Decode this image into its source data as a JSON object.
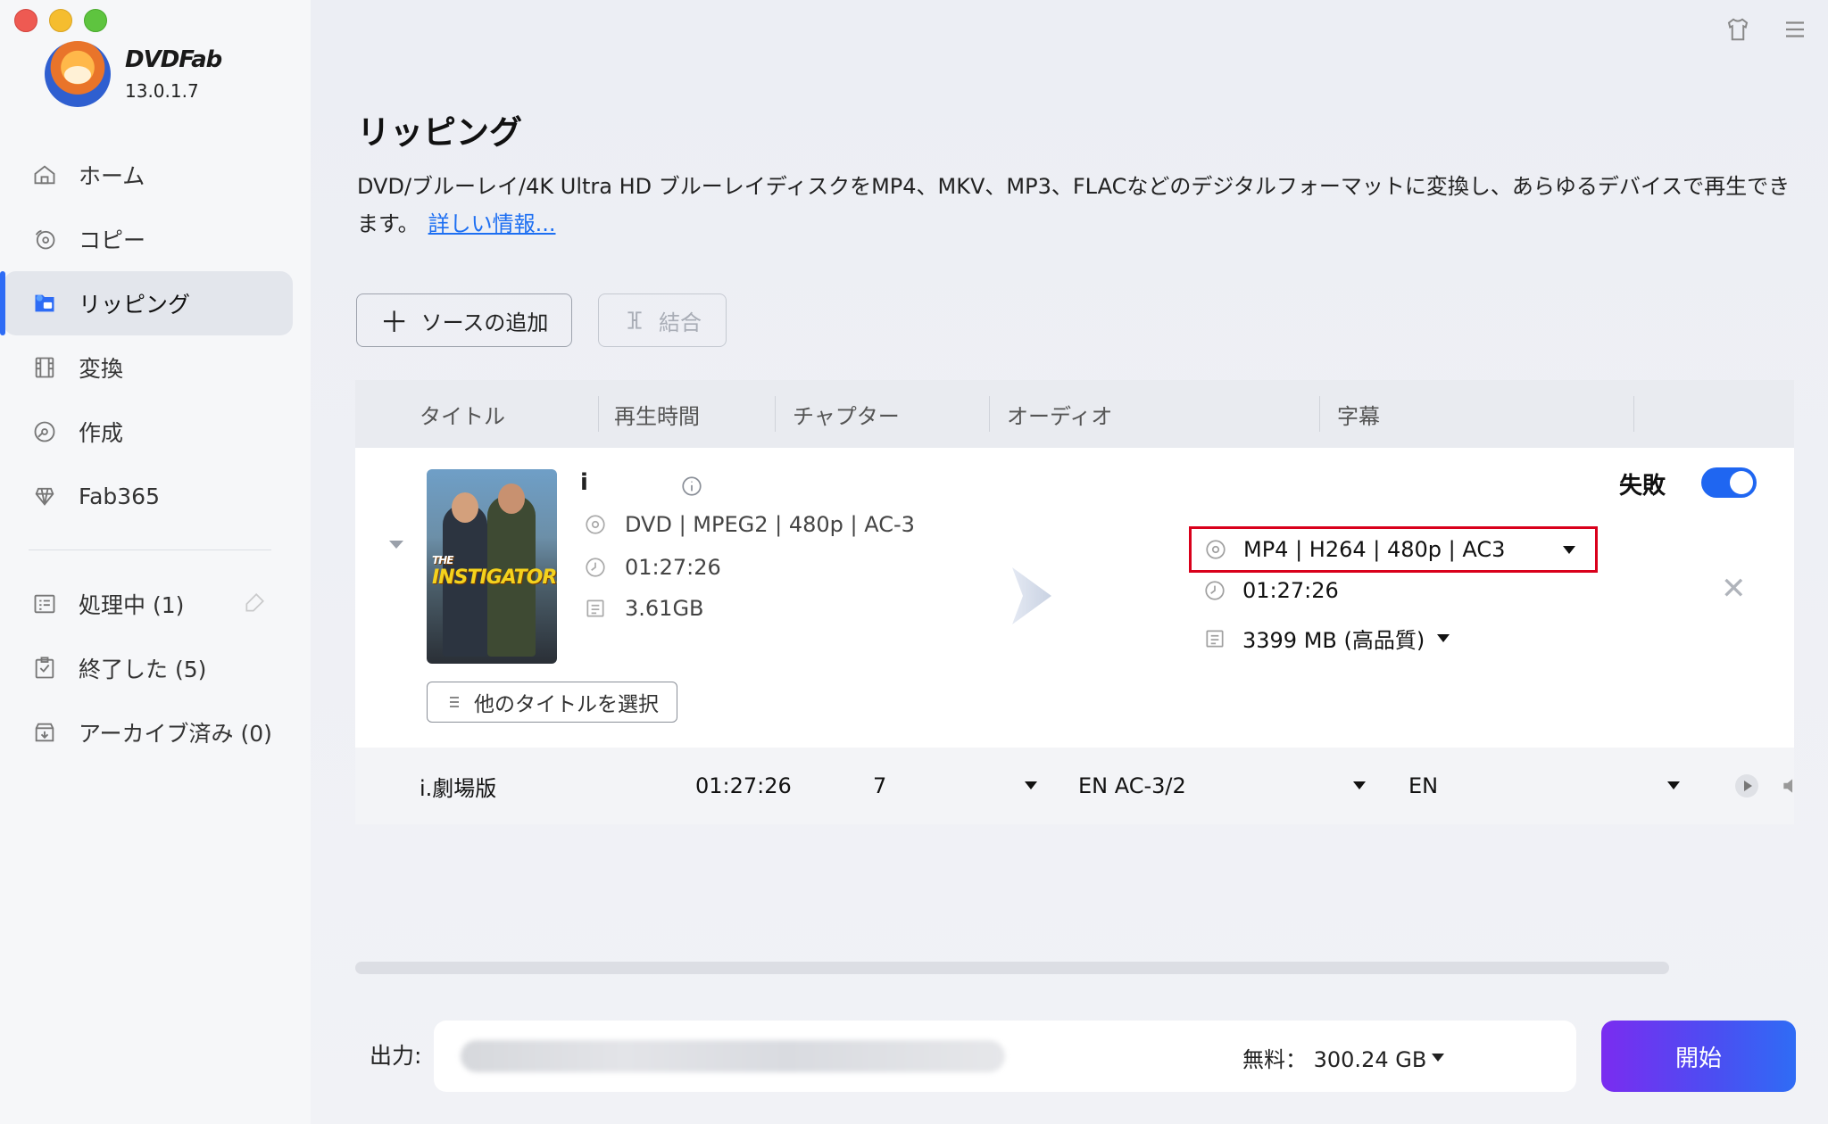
{
  "app": {
    "brand": "DVDFab",
    "version": "13.0.1.7"
  },
  "sidebar": {
    "items": [
      {
        "label": "ホーム",
        "icon": "home-icon"
      },
      {
        "label": "コピー",
        "icon": "copy-icon"
      },
      {
        "label": "リッピング",
        "icon": "ripper-icon",
        "active": true
      },
      {
        "label": "変換",
        "icon": "convert-icon"
      },
      {
        "label": "作成",
        "icon": "create-icon"
      },
      {
        "label": "Fab365",
        "icon": "fab365-icon"
      }
    ],
    "queue": [
      {
        "label": "処理中 (1)",
        "icon": "processing-icon"
      },
      {
        "label": "終了した (5)",
        "icon": "finished-icon"
      },
      {
        "label": "アーカイブ済み (0)",
        "icon": "archive-icon"
      }
    ]
  },
  "main": {
    "title": "リッピング",
    "description": "DVD/ブルーレイ/4K Ultra HD ブルーレイディスクをMP4、MKV、MP3、FLACなどのデジタルフォーマットに変換し、あらゆるデバイスで再生できます。",
    "more_link": "詳しい情報...",
    "add_source_label": "ソースの追加",
    "merge_label": "結合",
    "columns": [
      "タイトル",
      "再生時間",
      "チャプター",
      "オーディオ",
      "字幕"
    ]
  },
  "item": {
    "title": "i",
    "poster_title": "INSTIGATORS",
    "poster_prefix": "THE",
    "source_format": "DVD | MPEG2 | 480p | AC-3",
    "source_duration": "01:27:26",
    "source_size": "3.61GB",
    "select_other_label": "他のタイトルを選択",
    "status": "失敗",
    "output_profile": "MP4 | H264 | 480p | AC3",
    "output_duration": "01:27:26",
    "output_size": "3399 MB (高品質)"
  },
  "subrow": {
    "title": "i.劇場版",
    "duration": "01:27:26",
    "chapters": "7",
    "audio": "EN  AC-3/2",
    "subtitle": "EN"
  },
  "footer": {
    "output_label": "出力:",
    "free_space": "無料： 300.24 GB",
    "start_label": "開始"
  },
  "colors": {
    "accent": "#1f66f1",
    "highlight_border": "#d9001b",
    "start_gradient_from": "#7a2cf0",
    "start_gradient_to": "#2f6cf5"
  }
}
